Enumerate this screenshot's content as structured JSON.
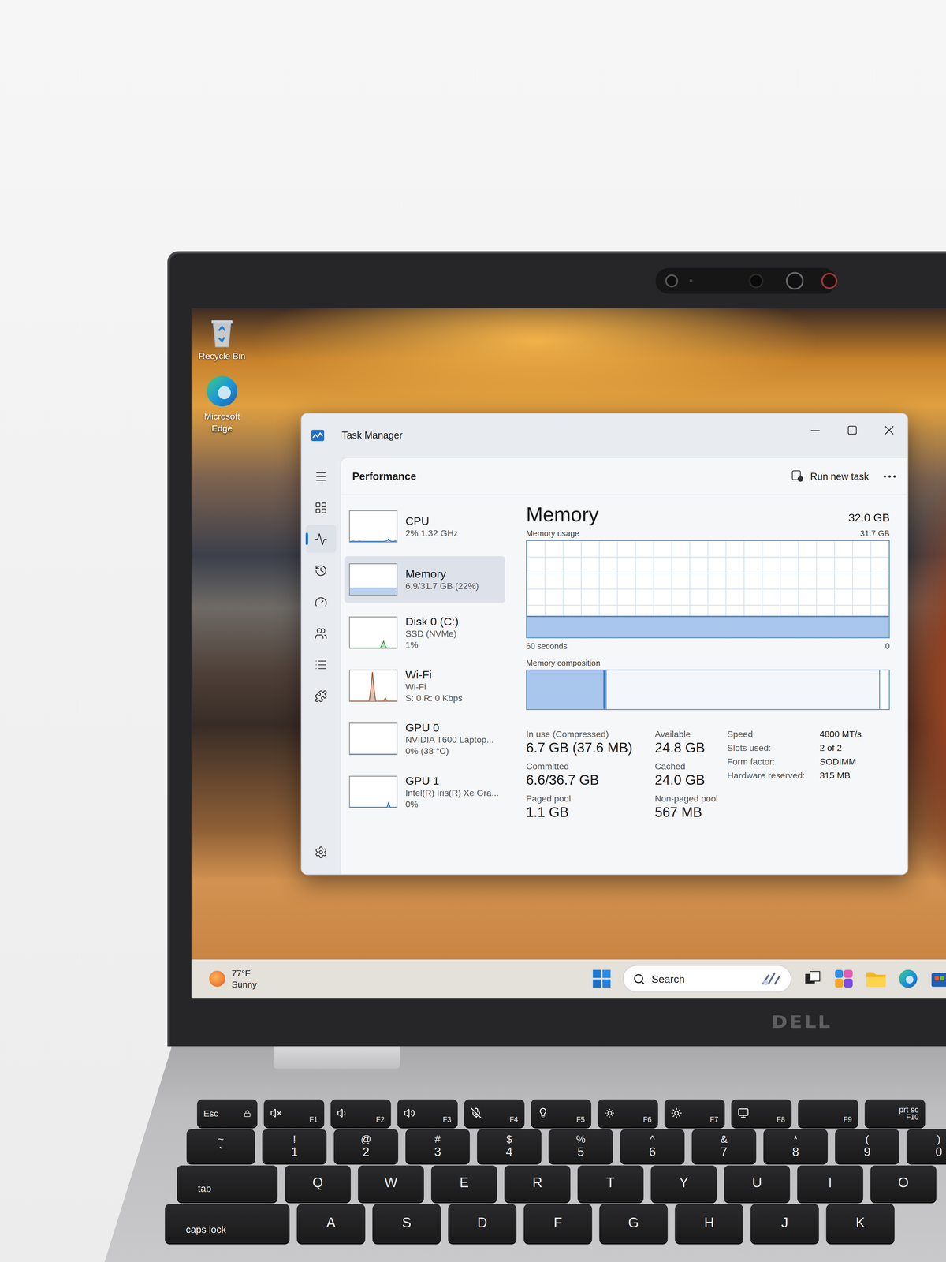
{
  "desktop": {
    "icons": [
      {
        "label": "Recycle Bin",
        "kind": "recycle-bin"
      },
      {
        "label": "Microsoft Edge",
        "kind": "edge"
      }
    ]
  },
  "window": {
    "title": "Task Manager"
  },
  "nav": [
    {
      "kind": "menu",
      "selected": false
    },
    {
      "kind": "processes",
      "selected": false
    },
    {
      "kind": "performance",
      "selected": true
    },
    {
      "kind": "app-history",
      "selected": false
    },
    {
      "kind": "startup",
      "selected": false
    },
    {
      "kind": "users",
      "selected": false
    },
    {
      "kind": "details",
      "selected": false
    },
    {
      "kind": "services",
      "selected": false
    },
    {
      "kind": "settings",
      "selected": false
    }
  ],
  "header": {
    "title": "Performance",
    "action": "Run new task"
  },
  "resources": [
    {
      "name": "CPU",
      "lines": [
        "2% 1.32 GHz"
      ],
      "selected": false,
      "color": "#1f6fc6",
      "series": [
        1,
        1,
        2,
        1,
        1,
        1,
        2,
        1,
        1,
        1,
        1,
        1,
        1,
        1,
        1,
        1,
        1,
        1,
        1,
        1,
        1,
        1,
        2,
        3,
        9,
        3,
        1,
        1,
        2,
        2
      ]
    },
    {
      "name": "Memory",
      "lines": [
        "6.9/31.7 GB (22%)"
      ],
      "selected": true,
      "color": "#3f7fcf",
      "series": [
        22,
        22,
        22,
        22,
        22,
        22,
        22,
        22,
        22,
        22,
        22,
        22,
        22,
        22,
        22,
        22,
        22,
        22,
        22,
        22,
        22,
        22,
        22,
        22,
        22,
        22,
        22,
        22,
        22,
        22
      ]
    },
    {
      "name": "Disk 0 (C:)",
      "lines": [
        "SSD (NVMe)",
        "1%"
      ],
      "selected": false,
      "color": "#3f9a46",
      "series": [
        0,
        0,
        0,
        0,
        0,
        0,
        0,
        0,
        0,
        0,
        0,
        0,
        0,
        0,
        0,
        0,
        0,
        0,
        0,
        0,
        12,
        22,
        6,
        0,
        0,
        0,
        0,
        0,
        0,
        0
      ]
    },
    {
      "name": "Wi-Fi",
      "lines": [
        "Wi-Fi",
        "S: 0 R: 0 Kbps"
      ],
      "selected": false,
      "color": "#a0522d",
      "series": [
        0,
        0,
        0,
        0,
        0,
        0,
        0,
        0,
        0,
        0,
        0,
        0,
        0,
        40,
        95,
        40,
        0,
        0,
        0,
        0,
        0,
        0,
        10,
        0,
        0,
        0,
        0,
        0,
        0,
        0
      ]
    },
    {
      "name": "GPU 0",
      "lines": [
        "NVIDIA T600 Laptop...",
        "0% (38 °C)"
      ],
      "selected": false,
      "color": "#1f6fc6",
      "series": [
        0,
        0,
        0,
        0,
        0,
        0,
        0,
        0,
        0,
        0,
        0,
        0,
        0,
        0,
        0,
        0,
        0,
        0,
        0,
        0,
        0,
        0,
        0,
        0,
        0,
        0,
        0,
        0,
        0,
        0
      ]
    },
    {
      "name": "GPU 1",
      "lines": [
        "Intel(R) Iris(R) Xe Gra...",
        "0%"
      ],
      "selected": false,
      "color": "#1f6fc6",
      "series": [
        0,
        0,
        0,
        0,
        0,
        0,
        0,
        0,
        0,
        0,
        0,
        0,
        0,
        0,
        0,
        0,
        0,
        0,
        0,
        0,
        0,
        0,
        0,
        0,
        15,
        0,
        0,
        0,
        0,
        0
      ]
    }
  ],
  "memory": {
    "title": "Memory",
    "total": "32.0 GB",
    "usage_label": "Memory usage",
    "usage_max": "31.7 GB",
    "usage_max_value": 31.7,
    "usage": [
      6.9,
      6.9,
      6.9,
      6.9,
      6.9,
      6.9,
      6.9,
      6.9,
      6.9,
      6.9,
      6.9,
      6.9,
      6.9,
      6.9,
      6.9,
      6.9,
      6.9,
      6.9,
      6.9,
      6.9,
      6.9,
      6.9,
      6.9,
      6.9,
      6.9,
      6.9,
      6.9,
      6.9,
      6.9,
      6.9,
      6.9,
      6.9,
      6.9,
      6.9,
      6.9,
      6.9,
      6.9,
      6.9,
      6.9,
      6.9,
      6.9,
      6.9,
      6.9,
      6.9,
      6.9,
      6.9,
      6.9,
      6.9,
      6.9,
      6.9,
      6.9,
      6.9,
      6.9,
      6.9,
      6.9,
      6.9,
      6.9,
      6.9,
      6.9,
      6.9
    ],
    "axis_start": "60 seconds",
    "axis_end": "0",
    "composition_label": "Memory composition",
    "composition": [
      {
        "kind": "in-use",
        "level": 0.216
      },
      {
        "kind": "modified",
        "level": 0.004
      },
      {
        "kind": "standby",
        "level": 0.755
      },
      {
        "kind": "free",
        "level": 0.025
      }
    ],
    "stats": [
      {
        "label": "In use (Compressed)",
        "value": "6.7 GB (37.6 MB)"
      },
      {
        "label": "Available",
        "value": "24.8 GB"
      },
      {
        "label": "Committed",
        "value": "6.6/36.7 GB"
      },
      {
        "label": "Cached",
        "value": "24.0 GB"
      },
      {
        "label": "Paged pool",
        "value": "1.1 GB"
      },
      {
        "label": "Non-paged pool",
        "value": "567 MB"
      }
    ],
    "specs": [
      {
        "label": "Speed:",
        "value": "4800 MT/s"
      },
      {
        "label": "Slots used:",
        "value": "2 of 2"
      },
      {
        "label": "Form factor:",
        "value": "SODIMM"
      },
      {
        "label": "Hardware reserved:",
        "value": "315 MB"
      }
    ]
  },
  "taskbar": {
    "weather": {
      "temperature": "77°F",
      "condition": "Sunny"
    },
    "search": {
      "placeholder": "Search"
    }
  },
  "brand": "DELL",
  "keyboard": [
    {
      "keys": [
        {
          "kind": "esc",
          "label": "Esc"
        },
        {
          "kind": "fn",
          "label": "F1"
        },
        {
          "kind": "fn",
          "label": "F2"
        },
        {
          "kind": "fn",
          "label": "F3"
        },
        {
          "kind": "fn",
          "label": "F4"
        },
        {
          "kind": "fn",
          "label": "F5"
        },
        {
          "kind": "fn",
          "label": "F6"
        },
        {
          "kind": "fn",
          "label": "F7"
        },
        {
          "kind": "fn",
          "label": "F8"
        },
        {
          "kind": "fn",
          "label": "F9"
        },
        {
          "kind": "fn-text",
          "label": "prt sc",
          "sub": "F10"
        }
      ]
    },
    {
      "keys": [
        {
          "kind": "symbol",
          "top": "~",
          "label": "`"
        },
        {
          "kind": "digit",
          "top": "!",
          "label": "1"
        },
        {
          "kind": "digit",
          "top": "@",
          "label": "2"
        },
        {
          "kind": "digit",
          "top": "#",
          "label": "3"
        },
        {
          "kind": "digit",
          "top": "$",
          "label": "4"
        },
        {
          "kind": "digit",
          "top": "%",
          "label": "5"
        },
        {
          "kind": "digit",
          "top": "^",
          "label": "6"
        },
        {
          "kind": "digit",
          "top": "&",
          "label": "7"
        },
        {
          "kind": "digit",
          "top": "*",
          "label": "8"
        },
        {
          "kind": "digit",
          "top": "(",
          "label": "9"
        },
        {
          "kind": "digit",
          "top": ")",
          "label": "0"
        }
      ]
    },
    {
      "keys": [
        {
          "kind": "tab",
          "label": "tab"
        },
        {
          "kind": "letter",
          "label": "Q"
        },
        {
          "kind": "letter",
          "label": "W"
        },
        {
          "kind": "letter",
          "label": "E"
        },
        {
          "kind": "letter",
          "label": "R"
        },
        {
          "kind": "letter",
          "label": "T"
        },
        {
          "kind": "letter",
          "label": "Y"
        },
        {
          "kind": "letter",
          "label": "U"
        },
        {
          "kind": "letter",
          "label": "I"
        },
        {
          "kind": "letter",
          "label": "O"
        }
      ]
    },
    {
      "keys": [
        {
          "kind": "caps",
          "label": "caps lock"
        },
        {
          "kind": "letter",
          "label": "A"
        },
        {
          "kind": "letter",
          "label": "S"
        },
        {
          "kind": "letter",
          "label": "D"
        },
        {
          "kind": "letter",
          "label": "F"
        },
        {
          "kind": "letter",
          "label": "G"
        },
        {
          "kind": "letter",
          "label": "H"
        },
        {
          "kind": "letter",
          "label": "J"
        },
        {
          "kind": "letter",
          "label": "K"
        }
      ]
    }
  ]
}
